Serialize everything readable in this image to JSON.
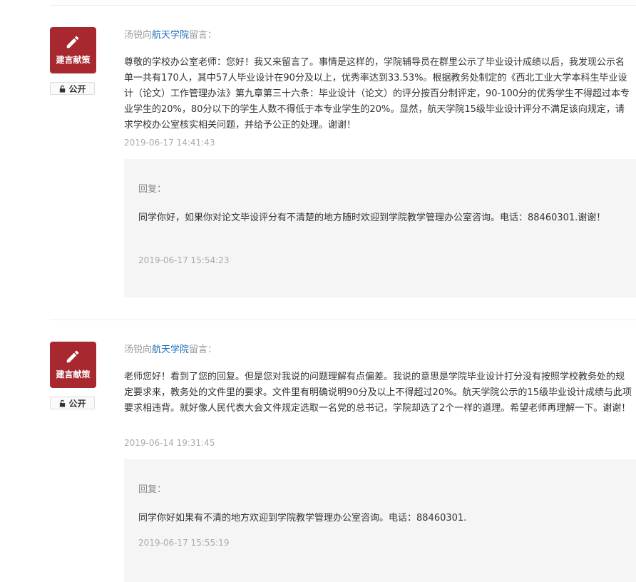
{
  "messages": [
    {
      "author": "汤锐向",
      "college": "航天学院",
      "suffix": "留言：",
      "category": "建言献策",
      "visibility": "公开",
      "content": "尊敬的学校办公室老师：您好！我又来留言了。事情是这样的，学院辅导员在群里公示了毕业设计成绩以后，我发现公示名单一共有170人，其中57人毕业设计在90分及以上，优秀率达到33.53%。根据教务处制定的《西北工业大学本科生毕业设计（论文）工作管理办法》第九章第三十六条：毕业设计（论文）的评分按百分制评定，90-100分的优秀学生不得超过本专业学生的20%，80分以下的学生人数不得低于本专业学生的20%。显然，航天学院15级毕业设计评分不满足该向规定，请求学校办公室核实相关问题，并给予公正的处理。谢谢！",
      "time": "2019-06-17 14:41:43",
      "reply": {
        "label": "回复：",
        "content": "同学你好，如果你对论文毕设评分有不清楚的地方随时欢迎到学院教学管理办公室咨询。电话：88460301.谢谢！",
        "time": "2019-06-17 15:54:23"
      }
    },
    {
      "author": "汤锐向",
      "college": "航天学院",
      "suffix": "留言：",
      "category": "建言献策",
      "visibility": "公开",
      "content": "老师您好！看到了您的回复。但是您对我说的问题理解有点偏差。我说的意思是学院毕业设计打分没有按照学校教务处的规定要求来，教务处的文件里的要求。文件里有明确说明90分及以上不得超过20%。航天学院公示的15级毕业设计成绩与此项要求相违背。就好像人民代表大会文件规定选取一名党的总书记，学院却选了2个一样的道理。希望老师再理解一下。谢谢！",
      "time": "2019-06-14 19:31:45",
      "reply": {
        "label": "回复：",
        "content": "同学你好如果有不清的地方欢迎到学院教学管理办公室咨询。电话：88460301.",
        "time": "2019-06-17 15:55:19"
      }
    }
  ],
  "icons": {
    "category": "pencil-icon",
    "visibility": "unlock-icon"
  },
  "colors": {
    "badge": "#a8282f",
    "link": "#1d6fb8",
    "reply_bg": "#f5f5f5"
  }
}
